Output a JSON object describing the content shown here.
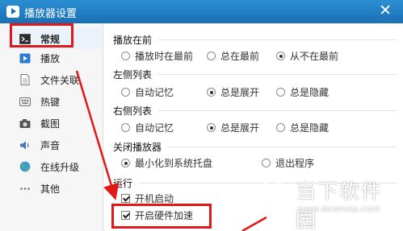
{
  "window": {
    "title": "播放器设置",
    "close_glyph": "✕"
  },
  "sidebar": {
    "items": [
      {
        "label": "常规",
        "icon": "terminal-icon",
        "active": true
      },
      {
        "label": "播放",
        "icon": "play-icon"
      },
      {
        "label": "文件关联",
        "icon": "file-icon"
      },
      {
        "label": "热键",
        "icon": "keyboard-icon"
      },
      {
        "label": "截图",
        "icon": "camera-icon"
      },
      {
        "label": "声音",
        "icon": "speaker-icon"
      },
      {
        "label": "在线升级",
        "icon": "globe-icon"
      },
      {
        "label": "其他",
        "icon": "more-icon"
      }
    ]
  },
  "sections": {
    "play_on_top": {
      "title": "播放在前",
      "options": [
        "播放时在最前",
        "总在最前",
        "从不在最前"
      ],
      "selected": 2
    },
    "left_list": {
      "title": "左侧列表",
      "options": [
        "自动记忆",
        "总是展开",
        "总是隐藏"
      ],
      "selected": 1
    },
    "right_list": {
      "title": "右侧列表",
      "options": [
        "自动记忆",
        "总是展开",
        "总是隐藏"
      ],
      "selected": 1
    },
    "close_player": {
      "title": "关闭播放器",
      "options": [
        "最小化到系统托盘",
        "退出程序"
      ],
      "selected": 0
    },
    "run": {
      "title": "运行",
      "checkboxes": [
        {
          "label": "开机启动",
          "checked": true
        },
        {
          "label": "开启硬件加速",
          "checked": true
        }
      ]
    }
  },
  "watermark": {
    "title": "当下软件园",
    "url": "www.downxia.com"
  },
  "colors": {
    "titlebar": "#1a6fb4",
    "annotation": "#e01818"
  }
}
